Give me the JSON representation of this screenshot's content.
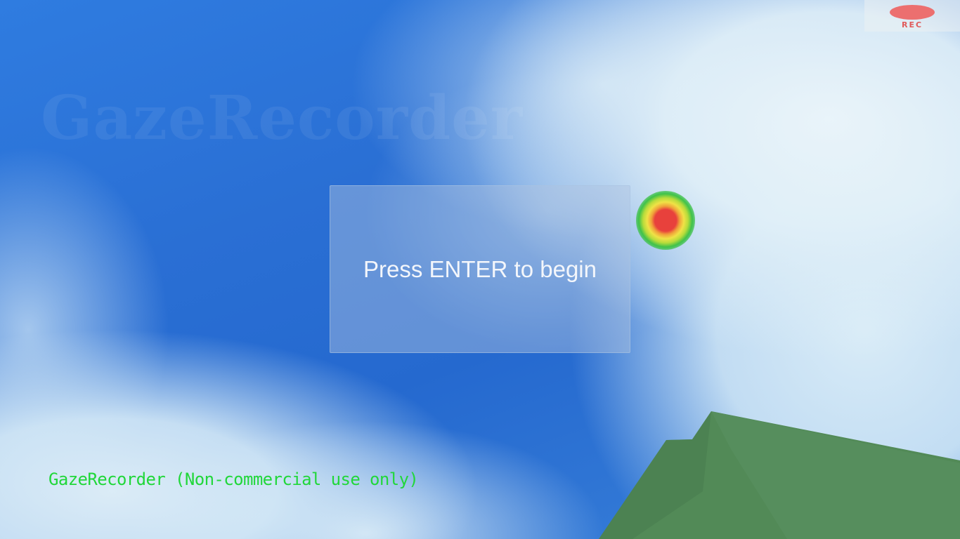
{
  "watermark": {
    "text": "GazeRecorder"
  },
  "recording": {
    "label": "REC",
    "dot_color": "#ec6f6f"
  },
  "start_panel": {
    "message": "Press ENTER to begin"
  },
  "gaze_marker": {
    "icon": "gaze-heatmap-icon",
    "colors": [
      "#e8413c",
      "#f0e246",
      "#3fc24a"
    ]
  },
  "license_note": {
    "text": "GazeRecorder (Non-commercial use only)",
    "color": "#21d73a"
  },
  "scene": {
    "sky_color": "#2a6fd4",
    "hill_color": "#4f8a58"
  }
}
